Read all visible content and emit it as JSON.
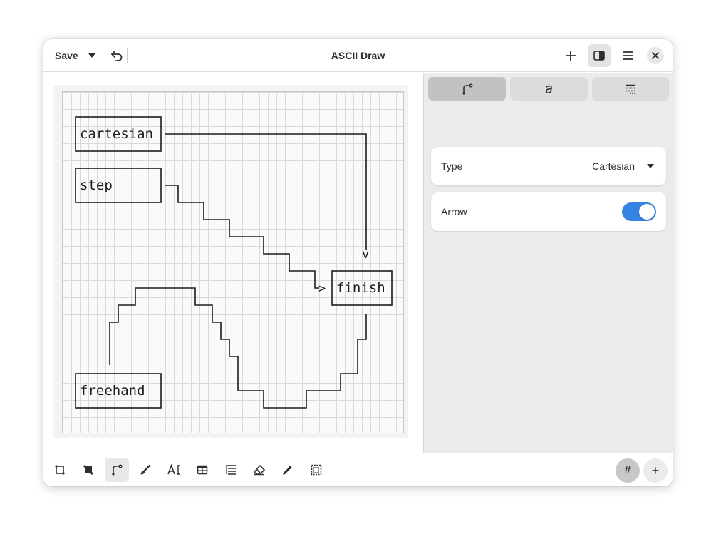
{
  "header": {
    "title": "ASCII Draw",
    "save_label": "Save"
  },
  "canvas": {
    "boxes": {
      "cartesian": "cartesian",
      "step": "step",
      "freehand": "freehand",
      "finish": "finish"
    },
    "arrows": {
      "down": "v",
      "right": ">"
    }
  },
  "sidebar": {
    "tabs": [
      {
        "icon": "line-tool-icon"
      },
      {
        "icon": "text-style-icon"
      },
      {
        "icon": "pattern-icon"
      }
    ],
    "type_label": "Type",
    "type_value": "Cartesian",
    "arrow_label": "Arrow",
    "arrow_on": true
  },
  "toolbar": {
    "tools": [
      "rectangle-icon",
      "filled-rectangle-icon",
      "line-icon",
      "freehand-brush-icon",
      "text-icon",
      "table-icon",
      "tree-list-icon",
      "eraser-icon",
      "color-picker-icon",
      "select-icon"
    ],
    "active_tool": "line-icon",
    "grid_label": "#",
    "add_label": "+"
  },
  "colors": {
    "accent": "#3584e4",
    "window_bg": "#ffffff",
    "sidebar_bg": "#ebebeb"
  }
}
